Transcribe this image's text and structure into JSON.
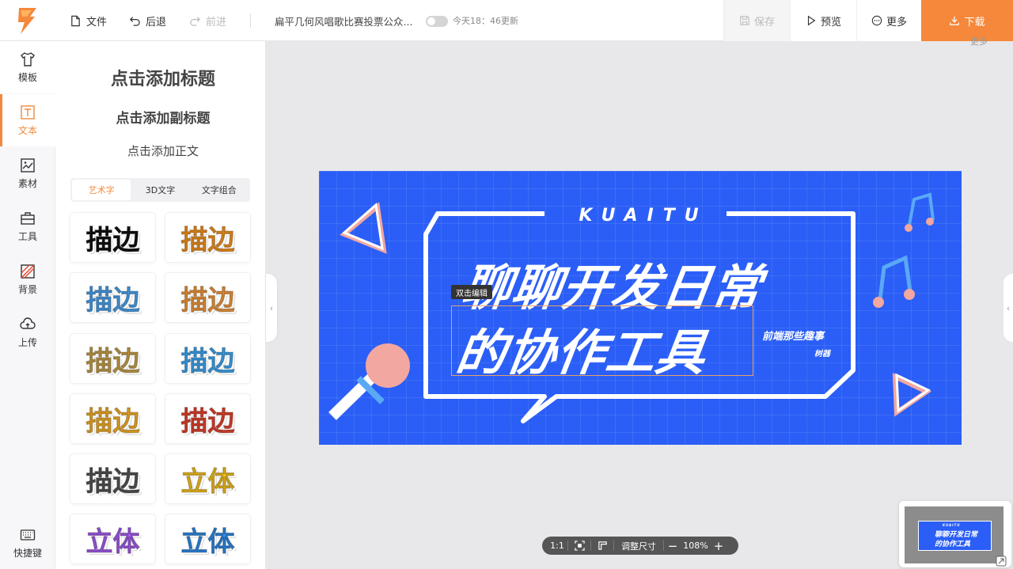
{
  "topbar": {
    "file_label": "文件",
    "undo_label": "后退",
    "redo_label": "前进",
    "doc_title": "扁平几何风唱歌比赛投票公众...",
    "save_status": "今天18：46更新",
    "save_label": "保存",
    "preview_label": "预览",
    "more_label": "更多",
    "download_label": "下载",
    "corner_more": "更多"
  },
  "leftnav": {
    "items": [
      {
        "label": "模板",
        "icon": "shirt-icon"
      },
      {
        "label": "文本",
        "icon": "text-icon"
      },
      {
        "label": "素材",
        "icon": "image-icon"
      },
      {
        "label": "工具",
        "icon": "toolbox-icon"
      },
      {
        "label": "背景",
        "icon": "background-icon"
      },
      {
        "label": "上传",
        "icon": "upload-icon"
      }
    ],
    "shortcut_label": "快捷键"
  },
  "panel": {
    "add_title": "点击添加标题",
    "add_subtitle": "点击添加副标题",
    "add_body": "点击添加正文",
    "tabs": [
      "艺术字",
      "3D文字",
      "文字组合"
    ],
    "active_tab": "艺术字",
    "tiles": [
      {
        "text": "描边",
        "color": "#111111"
      },
      {
        "text": "描边",
        "color": "#f7941d"
      },
      {
        "text": "描边",
        "color": "#4aa3f0"
      },
      {
        "text": "描边",
        "color": "#f39a3c"
      },
      {
        "text": "描边",
        "color": "#c9a24a"
      },
      {
        "text": "描边",
        "color": "#3fa9f5"
      },
      {
        "text": "描边",
        "color": "#f7b026"
      },
      {
        "text": "描边",
        "color": "#e8432e"
      },
      {
        "text": "描边",
        "color": "#555555"
      },
      {
        "text": "立体",
        "color": "#f7c21e"
      },
      {
        "text": "立体",
        "color": "#a65cf0"
      },
      {
        "text": "立体",
        "color": "#2f8ce9"
      }
    ]
  },
  "canvas": {
    "brand": "KUAITU",
    "headline_line1": "聊聊开发日常",
    "headline_line2": "的协作工具",
    "sub_line1": "前端那些趣事",
    "sub_line2": "树器",
    "bg_color": "#2a5ef6",
    "tooltip": "双击编辑"
  },
  "zoombar": {
    "ratio_label": "1:1",
    "resize_label": "调整尺寸",
    "zoom": "108%"
  },
  "minimap": {
    "brand": "KUAITU",
    "line1": "聊聊开发日常",
    "line2": "的协作工具"
  }
}
